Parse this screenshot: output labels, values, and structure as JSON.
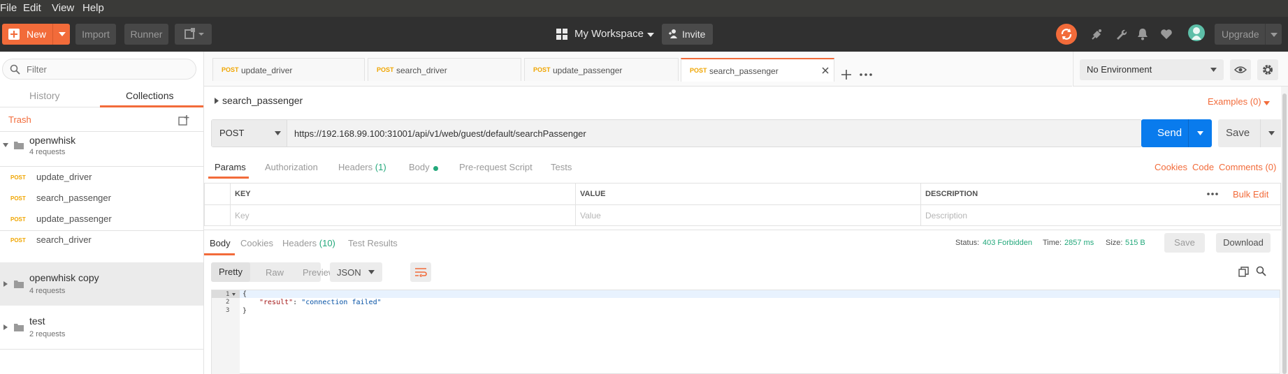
{
  "menu": [
    "File",
    "Edit",
    "View",
    "Help"
  ],
  "header": {
    "new_label": "New",
    "import_label": "Import",
    "runner_label": "Runner",
    "workspace_label": "My Workspace",
    "invite_label": "Invite",
    "upgrade_label": "Upgrade"
  },
  "sidebar": {
    "filter_placeholder": "Filter",
    "tabs": [
      "History",
      "Collections"
    ],
    "trash_label": "Trash",
    "collections": [
      {
        "name": "openwhisk",
        "count": "4 requests"
      },
      {
        "name": "openwhisk copy",
        "count": "4 requests"
      },
      {
        "name": "test",
        "count": "2 requests"
      }
    ],
    "requests": [
      {
        "method": "POST",
        "name": "update_driver"
      },
      {
        "method": "POST",
        "name": "search_passenger"
      },
      {
        "method": "POST",
        "name": "update_passenger"
      },
      {
        "method": "POST",
        "name": "search_driver"
      }
    ]
  },
  "tabs": [
    {
      "method": "POST",
      "name": "update_driver"
    },
    {
      "method": "POST",
      "name": "search_driver"
    },
    {
      "method": "POST",
      "name": "update_passenger"
    },
    {
      "method": "POST",
      "name": "search_passenger"
    }
  ],
  "environment": {
    "selected": "No Environment"
  },
  "request": {
    "title": "search_passenger",
    "examples_label": "Examples (0)",
    "method": "POST",
    "url": "https://192.168.99.100:31001/api/v1/web/guest/default/searchPassenger",
    "send_label": "Send",
    "save_label": "Save",
    "subtabs": {
      "params": "Params",
      "authorization": "Authorization",
      "headers": "Headers",
      "headers_count": "(1)",
      "body": "Body",
      "prerequest": "Pre-request Script",
      "tests": "Tests"
    },
    "links": {
      "cookies": "Cookies",
      "code": "Code",
      "comments": "Comments (0)"
    },
    "params_table": {
      "headers": [
        "KEY",
        "VALUE",
        "DESCRIPTION"
      ],
      "bulk_edit": "Bulk Edit",
      "placeholders": [
        "Key",
        "Value",
        "Description"
      ]
    }
  },
  "response": {
    "tabs": {
      "body": "Body",
      "cookies": "Cookies",
      "headers": "Headers",
      "headers_count": "(10)",
      "test_results": "Test Results"
    },
    "status_label": "Status:",
    "status_value": "403 Forbidden",
    "time_label": "Time:",
    "time_value": "2857 ms",
    "size_label": "Size:",
    "size_value": "515 B",
    "save_label": "Save",
    "download_label": "Download",
    "view_modes": [
      "Pretty",
      "Raw",
      "Preview"
    ],
    "format": "JSON",
    "code_lines": [
      {
        "num": "1",
        "text": "{"
      },
      {
        "num": "2",
        "key": "\"result\"",
        "sep": ": ",
        "value": "\"connection failed\""
      },
      {
        "num": "3",
        "text": "}"
      }
    ]
  },
  "colors": {
    "accent": "#f26b3a",
    "send_blue": "#097bed",
    "status_green": "#23a87b",
    "method_orange": "#f0a500"
  }
}
